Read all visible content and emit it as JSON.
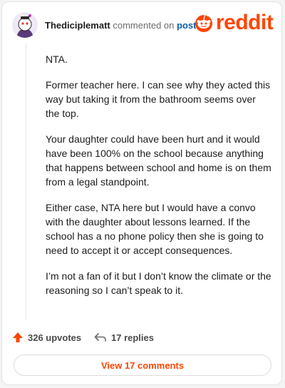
{
  "comment": {
    "username": "Thediciplematt",
    "action_text": "commented on",
    "post_link": "post",
    "paragraphs": [
      "NTA.",
      "Former teacher here. I can see why they acted this way but taking it from the bathroom seems over the top.",
      "Your daughter could have been hurt and it would have been 100% on the school because anything that happens between school and home is on them from a legal standpoint.",
      "Either case, NTA here but I would have a convo with the daughter about lessons learned. If the school has a no phone policy then she is going to need to accept it or accept consequences.",
      "I’m not a fan of it but I don’t know the climate or the reasoning so I can’t speak to it."
    ],
    "upvotes": "326 upvotes",
    "replies": "17 replies",
    "view_button": "View 17 comments"
  },
  "brand": {
    "name": "reddit",
    "color": "#ff4500"
  },
  "icons": {
    "avatar": "snoo-avatar",
    "logo": "reddit-snoo-icon",
    "upvote": "upvote-arrow-icon",
    "reply": "reply-arrow-icon"
  }
}
